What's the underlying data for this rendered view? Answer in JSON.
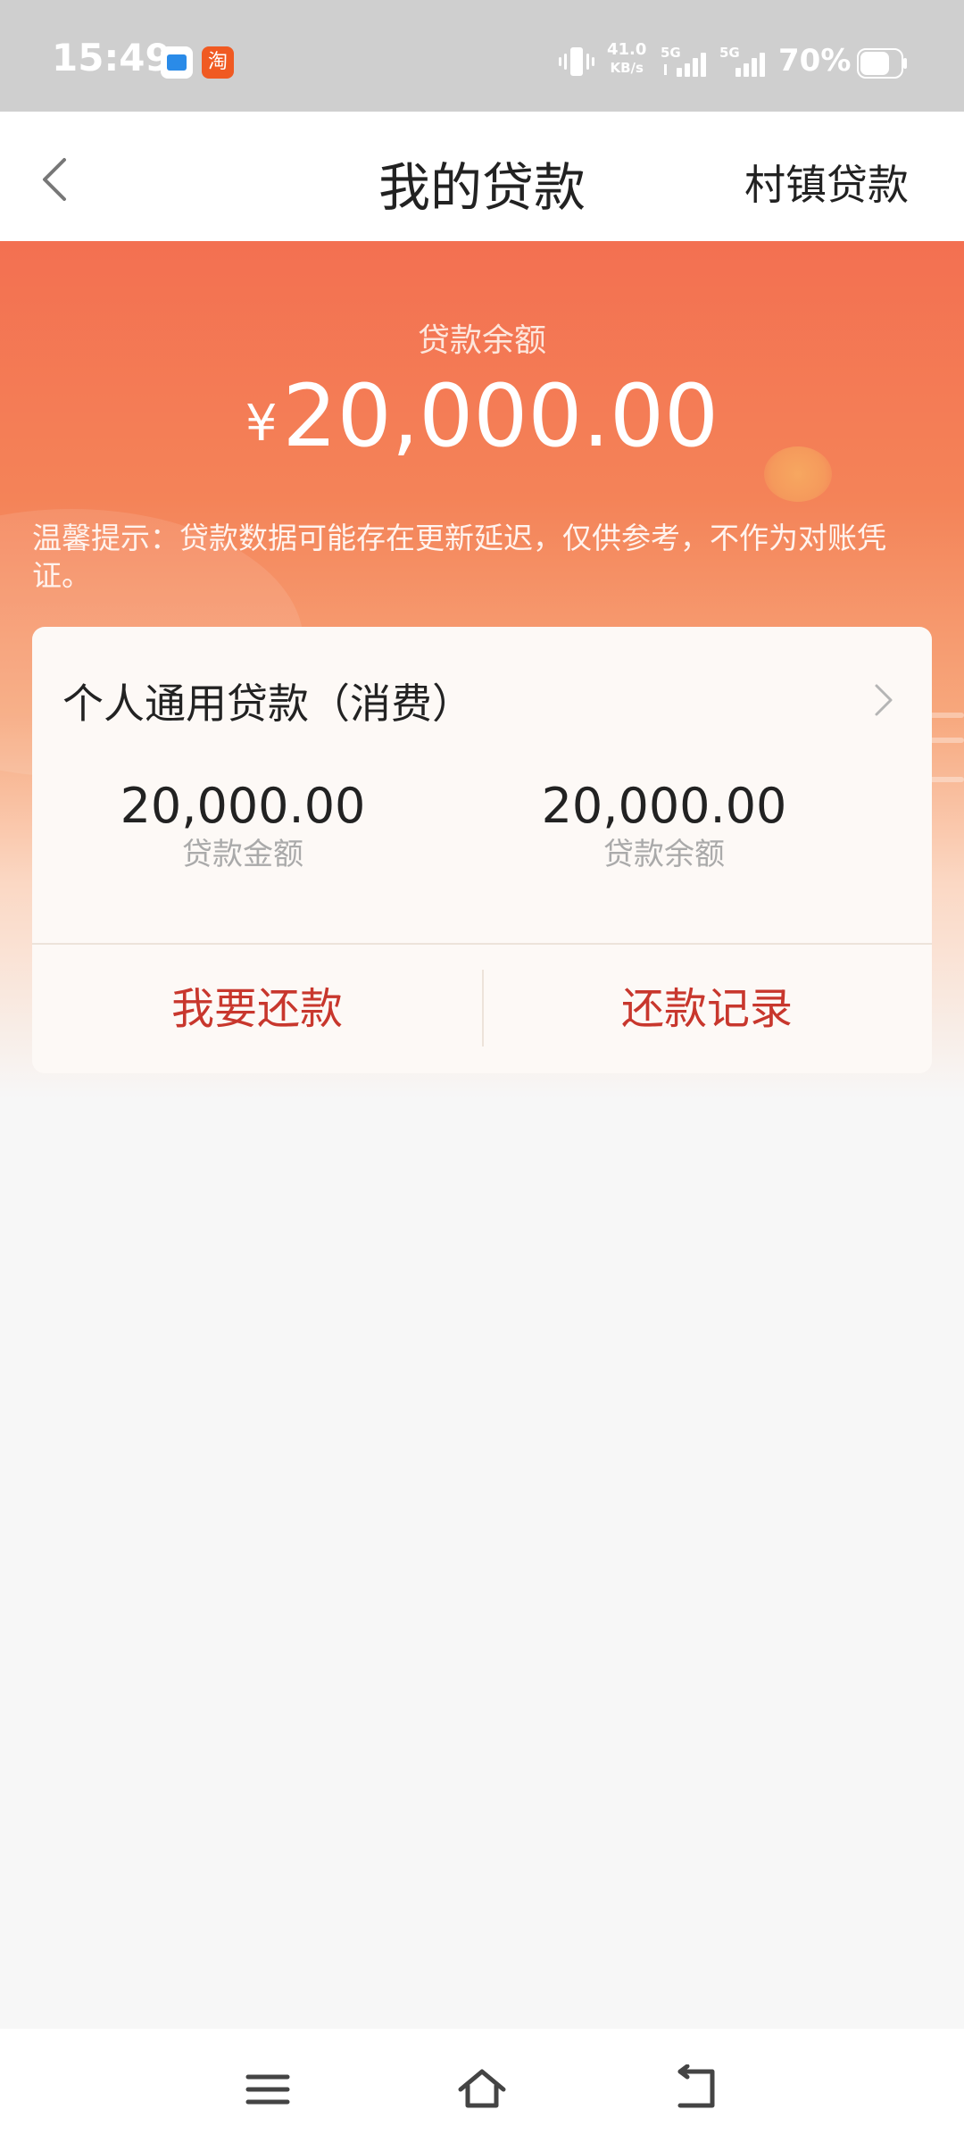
{
  "status_bar": {
    "time": "15:49",
    "taobao_icon_text": "淘",
    "net_speed_value": "41.0",
    "net_speed_unit": "KB/s",
    "signal1_tag": "5G",
    "signal2_tag": "5G",
    "battery": "70%"
  },
  "nav": {
    "title": "我的贷款",
    "right_label": "村镇贷款"
  },
  "hero": {
    "balance_label": "贷款余额",
    "currency_symbol": "¥",
    "balance_amount": "20,000.00",
    "notice": "温馨提示：贷款数据可能存在更新延迟，仅供参考，不作为对账凭证。"
  },
  "loan_card": {
    "title": "个人通用贷款（消费）",
    "loan_amount": "20,000.00",
    "loan_amount_label": "贷款金额",
    "loan_balance": "20,000.00",
    "loan_balance_label": "贷款余额",
    "repay_button": "我要还款",
    "records_button": "还款记录"
  },
  "colors": {
    "accent_red": "#c8372d",
    "hero_orange": "#f37051"
  }
}
